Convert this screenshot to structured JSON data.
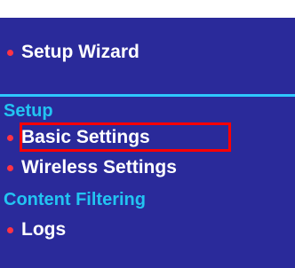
{
  "menu": {
    "setup_wizard": "Setup Wizard",
    "setup_heading": "Setup",
    "basic_settings": "Basic Settings",
    "wireless_settings": "Wireless Settings",
    "content_filtering_heading": "Content Filtering",
    "logs": "Logs"
  },
  "colors": {
    "panel_bg": "#2a2a9a",
    "section_text": "#22c4f2",
    "item_text": "#ffffff",
    "bullet": "#ff3344",
    "highlight_box": "#ff0000"
  }
}
